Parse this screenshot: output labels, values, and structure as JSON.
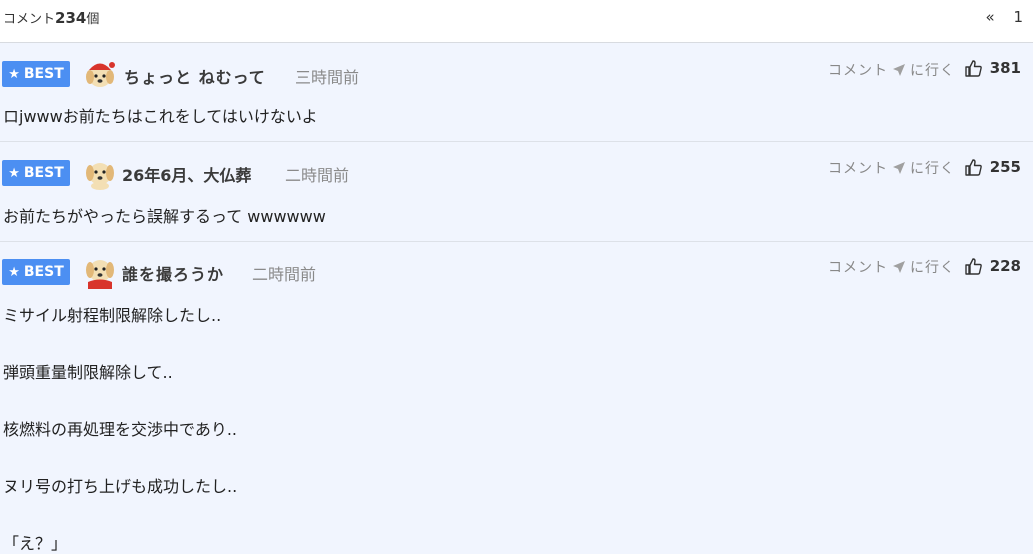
{
  "header": {
    "count_prefix": "コメント",
    "count_value": "234",
    "count_suffix": "個",
    "pager_prev": "«",
    "pager_page": "1"
  },
  "labels": {
    "best": "BEST",
    "goto_before": "コメント",
    "goto_after": "に行く"
  },
  "colors": {
    "badge": "#4c8ff2",
    "background": "#f1f5fe"
  },
  "comments": [
    {
      "author": "ちょっと ねむって",
      "time": "三時間前",
      "likes": "381",
      "avatar": "puppy-red-cap",
      "lines": [
        "ロjwwwお前たちはこれをしてはいけないよ"
      ]
    },
    {
      "author": "26年6月、大仏葬",
      "time": "二時間前",
      "likes": "255",
      "avatar": "puppy",
      "lines": [
        "お前たちがやったら誤解するって wwwwww"
      ]
    },
    {
      "author": "誰を撮ろうか",
      "time": "二時間前",
      "likes": "228",
      "avatar": "puppy-red-scarf",
      "lines": [
        "ミサイル射程制限解除したし..",
        "弾頭重量制限解除して..",
        "核燃料の再処理を交渉中であり..",
        "ヌリ号の打ち上げも成功したし..",
        "「え？」"
      ]
    }
  ]
}
